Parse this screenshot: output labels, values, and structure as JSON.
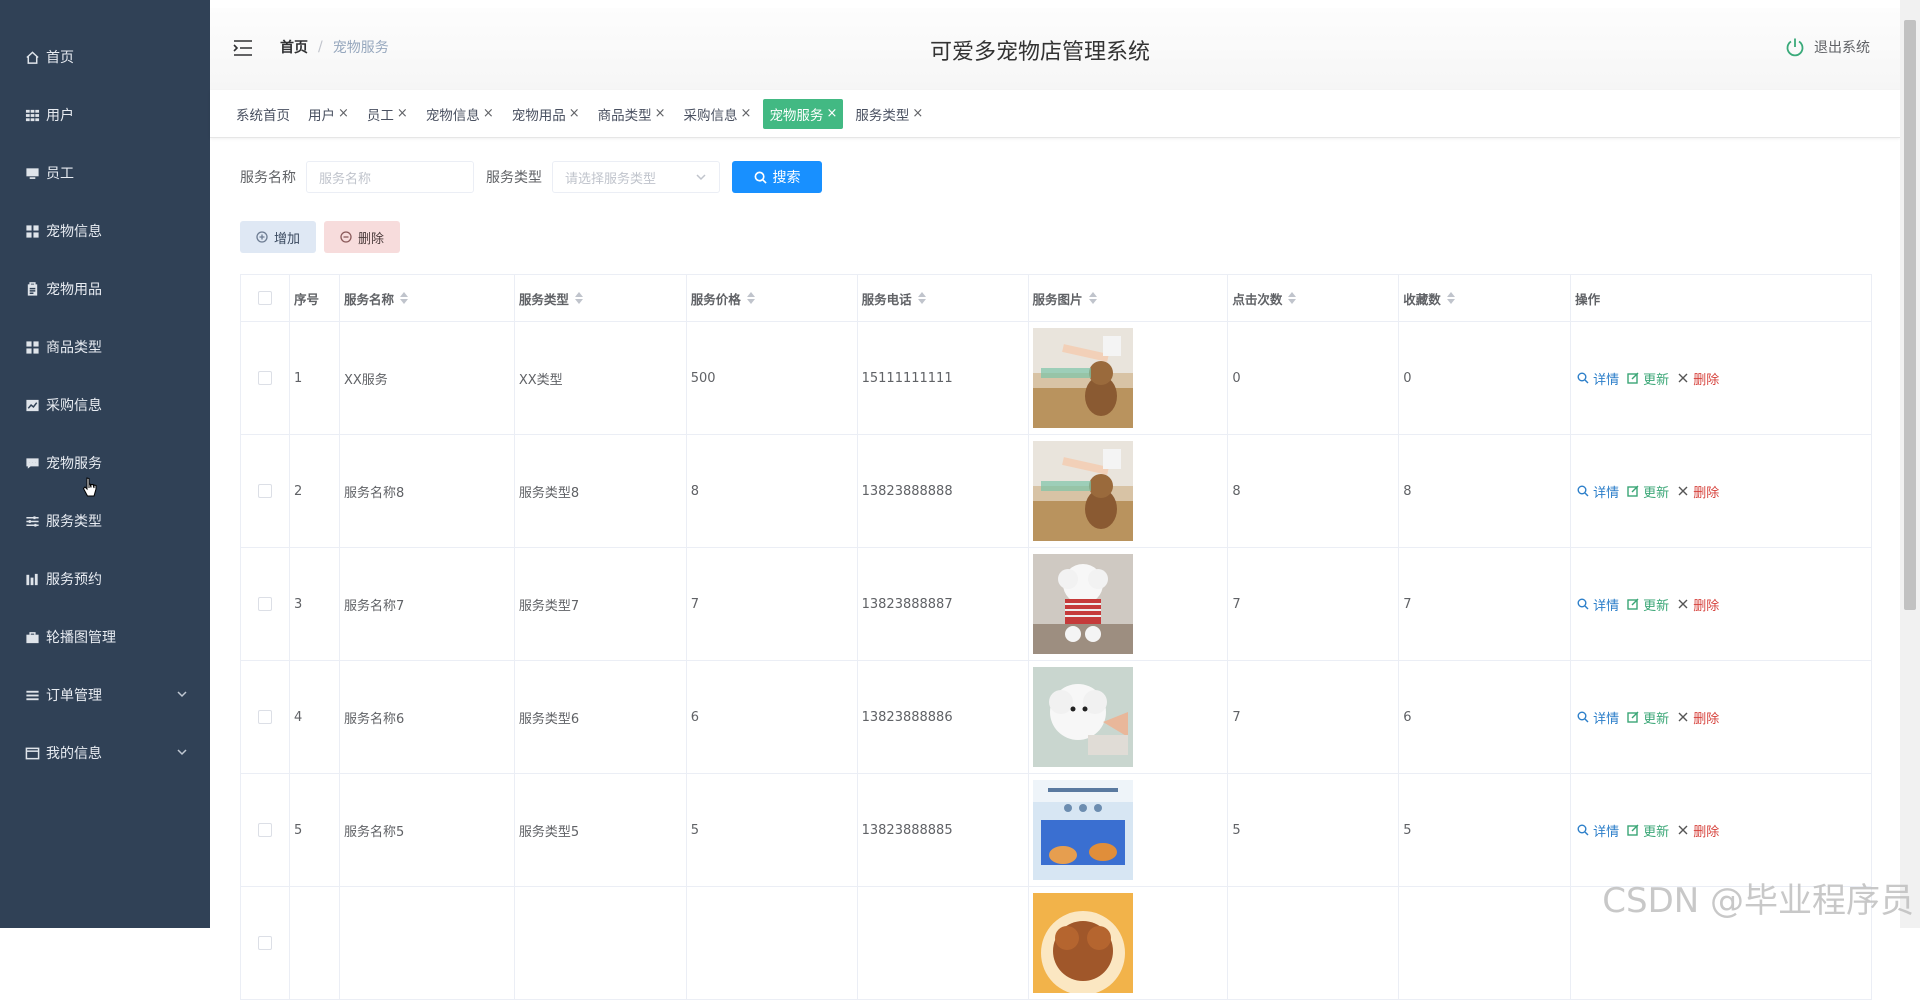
{
  "sidebar": {
    "items": [
      {
        "label": "首页",
        "icon": "home-icon"
      },
      {
        "label": "用户",
        "icon": "grid-icon"
      },
      {
        "label": "员工",
        "icon": "monitor-icon"
      },
      {
        "label": "宠物信息",
        "icon": "apps-icon"
      },
      {
        "label": "宠物用品",
        "icon": "clipboard-icon"
      },
      {
        "label": "商品类型",
        "icon": "apps-icon"
      },
      {
        "label": "采购信息",
        "icon": "chart-icon"
      },
      {
        "label": "宠物服务",
        "icon": "message-icon"
      },
      {
        "label": "服务类型",
        "icon": "sliders-icon"
      },
      {
        "label": "服务预约",
        "icon": "bar-chart-icon"
      },
      {
        "label": "轮播图管理",
        "icon": "briefcase-icon"
      },
      {
        "label": "订单管理",
        "icon": "list-icon"
      },
      {
        "label": "我的信息",
        "icon": "window-icon"
      }
    ]
  },
  "header": {
    "breadcrumb_home": "首页",
    "breadcrumb_sep": "/",
    "breadcrumb_current": "宠物服务",
    "title": "可爱多宠物店管理系统",
    "logout": "退出系统"
  },
  "tabs": [
    {
      "label": "系统首页",
      "closable": false,
      "active": false
    },
    {
      "label": "用户",
      "closable": true,
      "active": false
    },
    {
      "label": "员工",
      "closable": true,
      "active": false
    },
    {
      "label": "宠物信息",
      "closable": true,
      "active": false
    },
    {
      "label": "宠物用品",
      "closable": true,
      "active": false
    },
    {
      "label": "商品类型",
      "closable": true,
      "active": false
    },
    {
      "label": "采购信息",
      "closable": true,
      "active": false
    },
    {
      "label": "宠物服务",
      "closable": true,
      "active": true
    },
    {
      "label": "服务类型",
      "closable": true,
      "active": false
    }
  ],
  "tab_close_glyph": "×",
  "search": {
    "name_label": "服务名称",
    "name_placeholder": "服务名称",
    "type_label": "服务类型",
    "type_placeholder": "请选择服务类型",
    "button": "搜索"
  },
  "actions": {
    "add": "增加",
    "delete": "删除"
  },
  "table": {
    "columns": [
      "序号",
      "服务名称",
      "服务类型",
      "服务价格",
      "服务电话",
      "服务图片",
      "点击次数",
      "收藏数",
      "操作"
    ],
    "row_ops": {
      "detail": "详情",
      "update": "更新",
      "delete": "删除"
    },
    "rows": [
      {
        "no": "1",
        "name": "XX服务",
        "type": "XX类型",
        "price": "500",
        "phone": "15111111111",
        "clicks": "0",
        "favs": "0",
        "img": "dog-grooming"
      },
      {
        "no": "2",
        "name": "服务名称8",
        "type": "服务类型8",
        "price": "8",
        "phone": "13823888888",
        "clicks": "8",
        "favs": "8",
        "img": "dog-grooming"
      },
      {
        "no": "3",
        "name": "服务名称7",
        "type": "服务类型7",
        "price": "7",
        "phone": "13823888887",
        "clicks": "7",
        "favs": "7",
        "img": "white-poodle"
      },
      {
        "no": "4",
        "name": "服务名称6",
        "type": "服务类型6",
        "price": "6",
        "phone": "13823888886",
        "clicks": "7",
        "favs": "6",
        "img": "white-poodle-groom"
      },
      {
        "no": "5",
        "name": "服务名称5",
        "type": "服务类型5",
        "price": "5",
        "phone": "13823888885",
        "clicks": "5",
        "favs": "5",
        "img": "cat-hammock"
      },
      {
        "no": "",
        "name": "",
        "type": "",
        "price": "",
        "phone": "",
        "clicks": "",
        "favs": "",
        "img": "brown-poodle"
      }
    ]
  },
  "watermark": "CSDN @毕业程序员",
  "colors": {
    "sidebar_bg": "#304156",
    "active_tab": "#42b983",
    "primary": "#1890ff"
  }
}
